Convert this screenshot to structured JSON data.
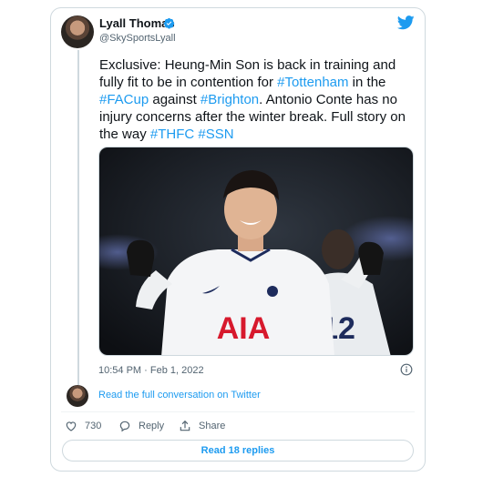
{
  "author": {
    "name": "Lyall Thomas",
    "handle": "@SkySportsLyall"
  },
  "tweet": {
    "segments": [
      {
        "text": "Exclusive: Heung-Min Son is back in training and fully fit to be in contention for ",
        "tag": false
      },
      {
        "text": "#Tottenham",
        "tag": true
      },
      {
        "text": " in the ",
        "tag": false
      },
      {
        "text": "#FACup",
        "tag": true
      },
      {
        "text": " against ",
        "tag": false
      },
      {
        "text": "#Brighton",
        "tag": true
      },
      {
        "text": ". Antonio Conte has no injury concerns after the winter break. Full story on the way ",
        "tag": false
      },
      {
        "text": "#THFC",
        "tag": true
      },
      {
        "text": " ",
        "tag": false
      },
      {
        "text": "#SSN",
        "tag": true
      }
    ],
    "timestamp": "10:54 PM · Feb 1, 2022"
  },
  "media": {
    "shirt_text": "AIA",
    "background_number": "12"
  },
  "conversation_link": "Read the full conversation on Twitter",
  "actions": {
    "likes": "730",
    "reply_label": "Reply",
    "share_label": "Share"
  },
  "read_replies": "Read 18 replies",
  "colors": {
    "accent": "#1d9bf0",
    "border": "#cfd9de",
    "muted": "#536471",
    "like": "#e0245e"
  },
  "icons": [
    "verified-badge-icon",
    "twitter-bird-icon",
    "info-icon",
    "heart-icon",
    "reply-icon",
    "share-icon"
  ]
}
